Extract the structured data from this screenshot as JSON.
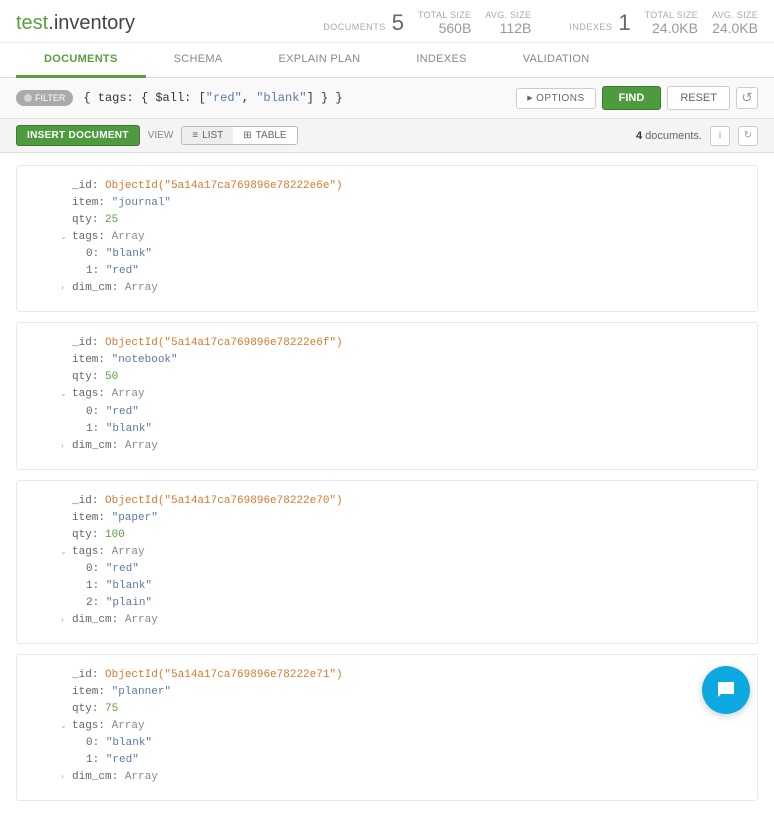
{
  "ns": {
    "db": "test",
    "coll": "inventory"
  },
  "stats": {
    "docs": {
      "label": "DOCUMENTS",
      "value": "5"
    },
    "total": {
      "label": "TOTAL SIZE",
      "value": "560B"
    },
    "avg": {
      "label": "AVG. SIZE",
      "value": "112B"
    },
    "idx": {
      "label": "INDEXES",
      "value": "1"
    },
    "itotal": {
      "label": "TOTAL SIZE",
      "value": "24.0KB"
    },
    "iavg": {
      "label": "AVG. SIZE",
      "value": "24.0KB"
    }
  },
  "tabs": [
    "DOCUMENTS",
    "SCHEMA",
    "EXPLAIN PLAN",
    "INDEXES",
    "VALIDATION"
  ],
  "filter": {
    "pill": "FILTER",
    "options": "OPTIONS",
    "find": "FIND",
    "reset": "RESET",
    "q_pre": "{ tags: { $all: [",
    "q_a": "\"red\"",
    "q_sep": ", ",
    "q_b": "\"blank\"",
    "q_post": "] } }"
  },
  "toolbar": {
    "insert": "INSERT DOCUMENT",
    "view": "VIEW",
    "list": "LIST",
    "table": "TABLE",
    "count": "4",
    "countLabel": "documents."
  },
  "results": [
    {
      "_id": "ObjectId(\"5a14a17ca769896e78222e6e\")",
      "item": "\"journal\"",
      "qty": "25",
      "tags": [
        "\"blank\"",
        "\"red\""
      ],
      "dim": "Array"
    },
    {
      "_id": "ObjectId(\"5a14a17ca769896e78222e6f\")",
      "item": "\"notebook\"",
      "qty": "50",
      "tags": [
        "\"red\"",
        "\"blank\""
      ],
      "dim": "Array"
    },
    {
      "_id": "ObjectId(\"5a14a17ca769896e78222e70\")",
      "item": "\"paper\"",
      "qty": "100",
      "tags": [
        "\"red\"",
        "\"blank\"",
        "\"plain\""
      ],
      "dim": "Array"
    },
    {
      "_id": "ObjectId(\"5a14a17ca769896e78222e71\")",
      "item": "\"planner\"",
      "qty": "75",
      "tags": [
        "\"blank\"",
        "\"red\""
      ],
      "dim": "Array"
    }
  ],
  "fieldLabels": {
    "id": "_id",
    "item": "item",
    "qty": "qty",
    "tags": "tags",
    "dim": "dim_cm",
    "arr": "Array"
  }
}
